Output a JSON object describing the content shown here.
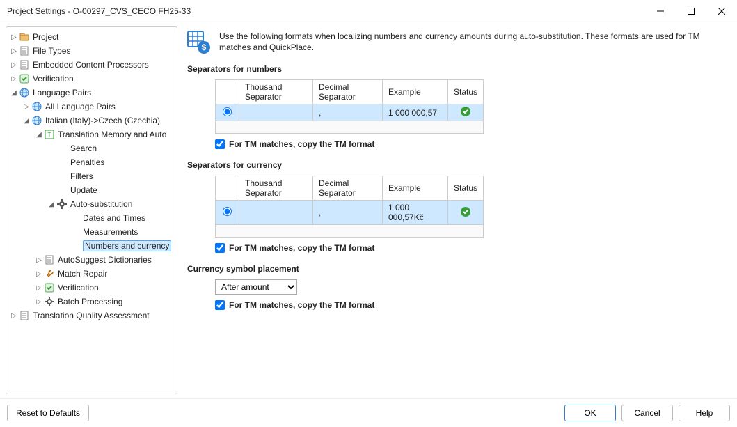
{
  "window": {
    "title": "Project Settings - O-00297_CVS_CECO FH25-33"
  },
  "tree": {
    "items": [
      {
        "label": "Project",
        "depth": 0,
        "expander": "▷",
        "icon": "settings-icon"
      },
      {
        "label": "File Types",
        "depth": 0,
        "expander": "▷",
        "icon": "doc-icon"
      },
      {
        "label": "Embedded Content Processors",
        "depth": 0,
        "expander": "▷",
        "icon": "doc-icon"
      },
      {
        "label": "Verification",
        "depth": 0,
        "expander": "▷",
        "icon": "check-icon"
      },
      {
        "label": "Language Pairs",
        "depth": 0,
        "expander": "◢",
        "icon": "lang-icon"
      },
      {
        "label": "All Language Pairs",
        "depth": 1,
        "expander": "▷",
        "icon": "lang-icon"
      },
      {
        "label": "Italian (Italy)->Czech (Czechia)",
        "depth": 1,
        "expander": "◢",
        "icon": "lang-icon"
      },
      {
        "label": "Translation Memory and Auto",
        "depth": 2,
        "expander": "◢",
        "icon": "tm-icon"
      },
      {
        "label": "Search",
        "depth": 3,
        "expander": "",
        "icon": ""
      },
      {
        "label": "Penalties",
        "depth": 3,
        "expander": "",
        "icon": ""
      },
      {
        "label": "Filters",
        "depth": 3,
        "expander": "",
        "icon": ""
      },
      {
        "label": "Update",
        "depth": 3,
        "expander": "",
        "icon": ""
      },
      {
        "label": "Auto-substitution",
        "depth": 3,
        "expander": "◢",
        "icon": "gear-icon"
      },
      {
        "label": "Dates and Times",
        "depth": 4,
        "expander": "",
        "icon": ""
      },
      {
        "label": "Measurements",
        "depth": 4,
        "expander": "",
        "icon": ""
      },
      {
        "label": "Numbers and currency",
        "depth": 4,
        "expander": "",
        "icon": "",
        "selected": true
      },
      {
        "label": "AutoSuggest Dictionaries",
        "depth": 2,
        "expander": "▷",
        "icon": "doc-icon"
      },
      {
        "label": "Match Repair",
        "depth": 2,
        "expander": "▷",
        "icon": "wrench-icon"
      },
      {
        "label": "Verification",
        "depth": 2,
        "expander": "▷",
        "icon": "check-icon"
      },
      {
        "label": "Batch Processing",
        "depth": 2,
        "expander": "▷",
        "icon": "gear-icon"
      },
      {
        "label": "Translation Quality Assessment",
        "depth": 0,
        "expander": "▷",
        "icon": "doc-icon"
      }
    ]
  },
  "content": {
    "intro_text": "Use the following formats when localizing numbers and currency amounts during auto-substitution. These formats are used for TM matches and QuickPlace.",
    "section_numbers_title": "Separators for numbers",
    "section_currency_title": "Separators for currency",
    "section_placement_title": "Currency symbol placement",
    "cols": {
      "thousand": "Thousand Separator",
      "decimal": "Decimal Separator",
      "example": "Example",
      "status": "Status"
    },
    "numbers_row": {
      "thousand": "",
      "decimal": ",",
      "example": "1 000 000,57"
    },
    "currency_row": {
      "thousand": "",
      "decimal": ",",
      "example": "1 000 000,57Kč"
    },
    "checkbox_label": "For TM matches, copy the TM format",
    "placement_select": {
      "value": "After amount"
    }
  },
  "footer": {
    "reset": "Reset to Defaults",
    "ok": "OK",
    "cancel": "Cancel",
    "help": "Help"
  }
}
